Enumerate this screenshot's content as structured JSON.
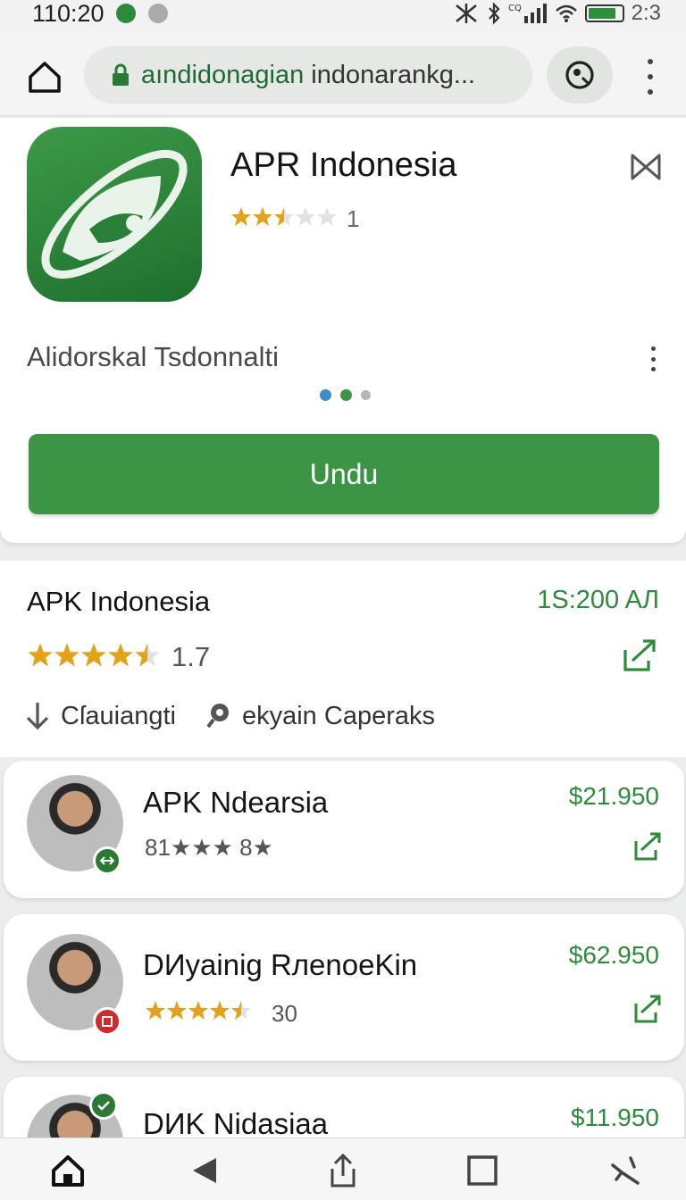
{
  "status_bar": {
    "time": "110:20",
    "right_text": "2:3",
    "battery_level": 0.85,
    "colors": {
      "accent_green": "#2f8e3a"
    }
  },
  "browser": {
    "url_highlight": "aındidonagian",
    "url_rest": " indonarankg...",
    "icons": [
      "home-icon",
      "lock-icon",
      "tab-switch-icon",
      "more-vert-icon"
    ]
  },
  "app_card": {
    "name": "APR Indonesia",
    "rating_stars": 2.5,
    "rating_count": "1",
    "subtitle": "Alidorskal Tsdonnalti",
    "pager": {
      "count": 3,
      "active": 0
    },
    "download_label": "Undu",
    "colors": {
      "button": "#3b9544",
      "icon_bg": "#2a8038"
    }
  },
  "detail": {
    "name": "APK Indonesia",
    "price": "1S:200 AЛ",
    "rating_stars": 4.5,
    "rating_value": "1.7",
    "meta_download": "Cſauiangti",
    "meta_search": "ekyain Caperaks"
  },
  "list": [
    {
      "title": "APK Ndearsia",
      "price": "$21.950",
      "sub_text": "81★★★ 8★",
      "rating_stars": null,
      "badge_color": "#2b7a34",
      "badge_icon": "swap-icon"
    },
    {
      "title": "DИyainig RлenoeKin",
      "price": "$62.950",
      "sub_text": "30",
      "rating_stars": 4.5,
      "badge_color": "#d22a2a",
      "badge_icon": "app-icon"
    },
    {
      "title": "DИK Nidasiaa",
      "price": "$11.950",
      "sub_text": "",
      "rating_stars": null,
      "badge_color": "#2b7a34",
      "badge_icon": "check-icon"
    }
  ],
  "bottom_nav": {
    "items": [
      "home-icon",
      "back-icon",
      "share-icon",
      "recents-icon",
      "tools-icon"
    ]
  }
}
